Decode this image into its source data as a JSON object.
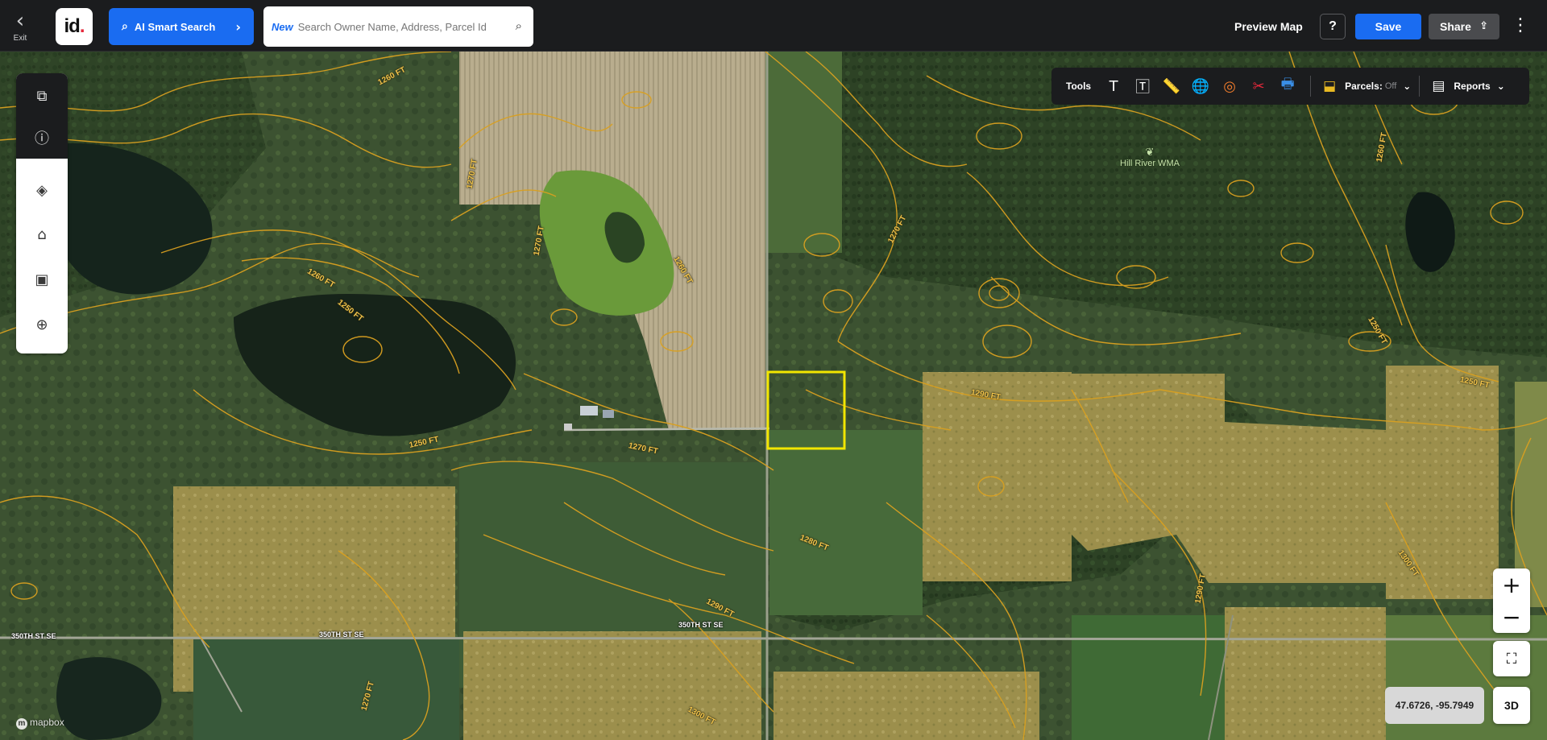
{
  "header": {
    "exit_label": "Exit",
    "logo_text": "id",
    "ai_search_label": "AI Smart Search",
    "search_badge": "New",
    "search_placeholder": "Search Owner Name, Address, Parcel Id",
    "preview_map_label": "Preview Map",
    "help_label": "?",
    "save_label": "Save",
    "share_label": "Share",
    "colors": {
      "accent": "#1a6cf1",
      "bar": "#1b1c1e",
      "logo_dot": "#e5283b"
    }
  },
  "side_panel": {
    "items": [
      {
        "icon": "panel-toggle-icon",
        "glyph": "⧉"
      },
      {
        "icon": "info-icon",
        "glyph": "ⓘ"
      },
      {
        "icon": "layers-icon",
        "glyph": "◈"
      },
      {
        "icon": "buildings-icon",
        "glyph": "⌂"
      },
      {
        "icon": "image-icon",
        "glyph": "▣"
      },
      {
        "icon": "add-location-icon",
        "glyph": "⊕"
      }
    ]
  },
  "toolbar": {
    "tools_label": "Tools",
    "tools": [
      {
        "icon": "text-icon",
        "glyph": "T",
        "color": "#ffffff"
      },
      {
        "icon": "text-box-icon",
        "glyph": "🅃",
        "color": "#ffffff"
      },
      {
        "icon": "ruler-icon",
        "glyph": "📏",
        "color": "#e8b923"
      },
      {
        "icon": "globe-pin-icon",
        "glyph": "🌐",
        "color": "#ffffff"
      },
      {
        "icon": "target-icon",
        "glyph": "◎",
        "color": "#f07c2c"
      },
      {
        "icon": "scissors-icon",
        "glyph": "✂",
        "color": "#e5283b"
      },
      {
        "icon": "print-icon",
        "glyph": "🖶",
        "color": "#3a8ee6"
      }
    ],
    "parcels_label": "Parcels:",
    "parcels_state": "Off",
    "reports_label": "Reports"
  },
  "map": {
    "contour_labels": [
      "1260 FT",
      "1270 FT",
      "1270 FT",
      "1260 FT",
      "1260 FT",
      "1250 FT",
      "1270 FT",
      "1250 FT",
      "1270 FT",
      "1280 FT",
      "1290 FT",
      "1290 FT",
      "1260 FT",
      "1250 FT",
      "1250 FT",
      "1300 FT",
      "1290 FT",
      "1270 FT",
      "1300 FT"
    ],
    "road_labels": [
      "350TH ST SE",
      "350TH ST SE",
      "350TH ST SE"
    ],
    "poi_label": "Hill River WMA",
    "coordinates": "47.6726, -95.7949",
    "zoom_in": "+",
    "zoom_out": "−",
    "three_d_label": "3D",
    "attribution": "mapbox",
    "contour_color": "#d9a020",
    "selection_color": "#f2e600"
  }
}
